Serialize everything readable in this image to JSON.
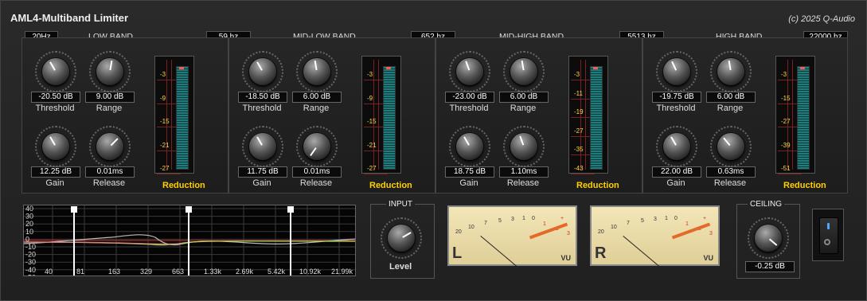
{
  "app": {
    "title": "AML4-Multiband Limiter",
    "copyright": "(c) 2025 Q-Audio"
  },
  "freq_labels": [
    "20Hz",
    "59 hz",
    "652 hz",
    "5513 hz",
    "22000 hz"
  ],
  "bands": [
    {
      "name": "LOW BAND",
      "threshold": "-20.50 dB",
      "range": "9.00 dB",
      "gain": "12.25 dB",
      "release": "0.01ms",
      "meter_scale": [
        "-3",
        "-9",
        "-15",
        "-21",
        "-27"
      ]
    },
    {
      "name": "MID-LOW BAND",
      "threshold": "-18.50 dB",
      "range": "6.00 dB",
      "gain": "11.75 dB",
      "release": "0.01ms",
      "meter_scale": [
        "-3",
        "-9",
        "-15",
        "-21",
        "-27"
      ]
    },
    {
      "name": "MID-HIGH BAND",
      "threshold": "-23.00 dB",
      "range": "6.00 dB",
      "gain": "18.75 dB",
      "release": "1.10ms",
      "meter_scale": [
        "-3",
        "-11",
        "-19",
        "-27",
        "-35",
        "-43"
      ]
    },
    {
      "name": "HIGH BAND",
      "threshold": "-19.75 dB",
      "range": "6.00 dB",
      "gain": "22.00 dB",
      "release": "0.63ms",
      "meter_scale": [
        "-3",
        "-15",
        "-27",
        "-39",
        "-51"
      ]
    }
  ],
  "labels": {
    "threshold": "Threshold",
    "range": "Range",
    "gain": "Gain",
    "release": "Release",
    "reduction": "Reduction"
  },
  "graph": {
    "y_ticks": [
      "40",
      "30",
      "20",
      "10",
      "0",
      "-10",
      "-20",
      "-30",
      "-40",
      "-50"
    ],
    "x_ticks": [
      "40",
      "81",
      "163",
      "329",
      "663",
      "1.33k",
      "2.69k",
      "5.42k",
      "10.92k",
      "21.99k"
    ]
  },
  "input": {
    "group_label": "INPUT",
    "knob_label": "Level"
  },
  "vu_meters": [
    {
      "channel": "L",
      "label": "VU",
      "scale": [
        "20",
        "10",
        "7",
        "5",
        "3",
        "1",
        "0"
      ],
      "scale_red": [
        "+",
        "1",
        "2",
        "3"
      ]
    },
    {
      "channel": "R",
      "label": "VU",
      "scale": [
        "20",
        "10",
        "7",
        "5",
        "3",
        "1",
        "0"
      ],
      "scale_red": [
        "+",
        "1",
        "2",
        "3"
      ]
    }
  ],
  "ceiling": {
    "group_label": "CEILING",
    "value": "-0.25 dB"
  },
  "colors": {
    "reduction_label": "#ffd000",
    "meter_bar": "#1e7c7c",
    "meter_scale": "#ffd54a",
    "vu_face": "#f3e6b7",
    "power_led": "#4aa8ff"
  }
}
